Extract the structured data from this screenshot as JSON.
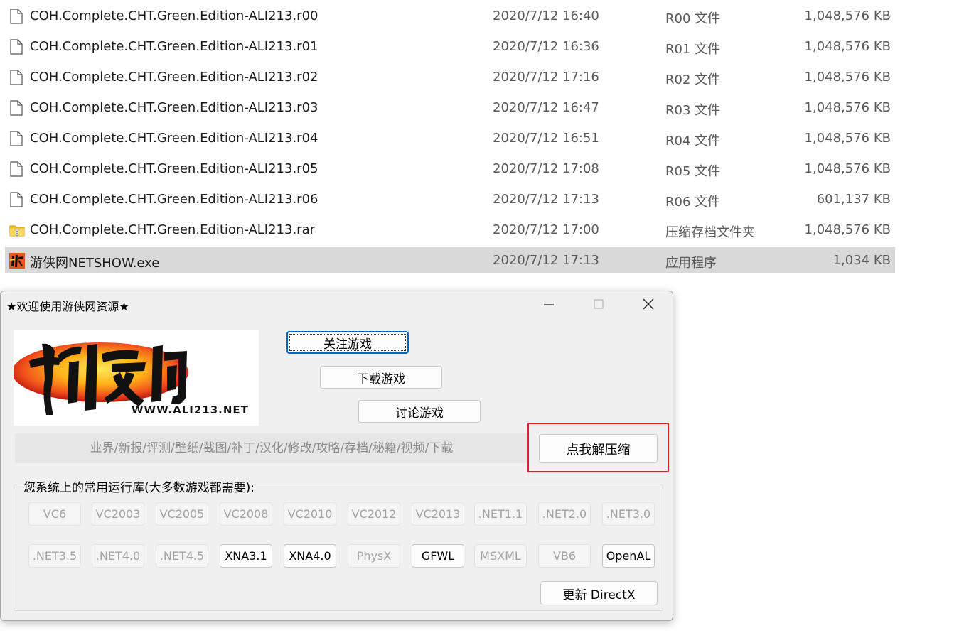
{
  "files": [
    {
      "name": "COH.Complete.CHT.Green.Edition-ALI213.r00",
      "date": "2020/7/12 16:40",
      "type": "R00 文件",
      "size": "1,048,576 KB",
      "icon": "document-icon",
      "selected": false
    },
    {
      "name": "COH.Complete.CHT.Green.Edition-ALI213.r01",
      "date": "2020/7/12 16:36",
      "type": "R01 文件",
      "size": "1,048,576 KB",
      "icon": "document-icon",
      "selected": false
    },
    {
      "name": "COH.Complete.CHT.Green.Edition-ALI213.r02",
      "date": "2020/7/12 17:16",
      "type": "R02 文件",
      "size": "1,048,576 KB",
      "icon": "document-icon",
      "selected": false
    },
    {
      "name": "COH.Complete.CHT.Green.Edition-ALI213.r03",
      "date": "2020/7/12 16:47",
      "type": "R03 文件",
      "size": "1,048,576 KB",
      "icon": "document-icon",
      "selected": false
    },
    {
      "name": "COH.Complete.CHT.Green.Edition-ALI213.r04",
      "date": "2020/7/12 16:51",
      "type": "R04 文件",
      "size": "1,048,576 KB",
      "icon": "document-icon",
      "selected": false
    },
    {
      "name": "COH.Complete.CHT.Green.Edition-ALI213.r05",
      "date": "2020/7/12 17:08",
      "type": "R05 文件",
      "size": "1,048,576 KB",
      "icon": "document-icon",
      "selected": false
    },
    {
      "name": "COH.Complete.CHT.Green.Edition-ALI213.r06",
      "date": "2020/7/12 17:13",
      "type": "R06 文件",
      "size": "601,137 KB",
      "icon": "document-icon",
      "selected": false
    },
    {
      "name": "COH.Complete.CHT.Green.Edition-ALI213.rar",
      "date": "2020/7/12 17:00",
      "type": "压缩存档文件夹",
      "size": "1,048,576 KB",
      "icon": "zip-folder-icon",
      "selected": false
    },
    {
      "name": "游侠网NETSHOW.exe",
      "date": "2020/7/12 17:13",
      "type": "应用程序",
      "size": "1,034 KB",
      "icon": "app-icon",
      "selected": true
    }
  ],
  "dialog": {
    "title": "★欢迎使用游侠网资源★",
    "banner_url": "WWW.ALI213.NET",
    "buttons": {
      "follow": "关注游戏",
      "download": "下载游戏",
      "discuss": "讨论游戏",
      "extract": "点我解压缩"
    },
    "category_bar": "业界/新报/评测/壁纸/截图/补丁/汉化/修改/攻略/存档/秘籍/视频/下载",
    "runtime_group_label": "您系统上的常用运行库(大多数游戏都需要):",
    "runtime_row1": [
      {
        "label": "VC6",
        "enabled": false
      },
      {
        "label": "VC2003",
        "enabled": false
      },
      {
        "label": "VC2005",
        "enabled": false
      },
      {
        "label": "VC2008",
        "enabled": false
      },
      {
        "label": "VC2010",
        "enabled": false
      },
      {
        "label": "VC2012",
        "enabled": false
      },
      {
        "label": "VC2013",
        "enabled": false
      },
      {
        "label": ".NET1.1",
        "enabled": false
      },
      {
        "label": ".NET2.0",
        "enabled": false
      },
      {
        "label": ".NET3.0",
        "enabled": false
      }
    ],
    "runtime_row2": [
      {
        "label": ".NET3.5",
        "enabled": false
      },
      {
        "label": ".NET4.0",
        "enabled": false
      },
      {
        "label": ".NET4.5",
        "enabled": false
      },
      {
        "label": "XNA3.1",
        "enabled": true
      },
      {
        "label": "XNA4.0",
        "enabled": true
      },
      {
        "label": "PhysX",
        "enabled": false
      },
      {
        "label": "GFWL",
        "enabled": true
      },
      {
        "label": "MSXML",
        "enabled": false
      },
      {
        "label": "VB6",
        "enabled": false
      },
      {
        "label": "OpenAL",
        "enabled": true
      }
    ],
    "update_directx": "更新 DirectX",
    "colors": {
      "highlight_box": "#e0201c",
      "focus": "#0067c0",
      "selected_row": "#d9d9d9"
    }
  }
}
